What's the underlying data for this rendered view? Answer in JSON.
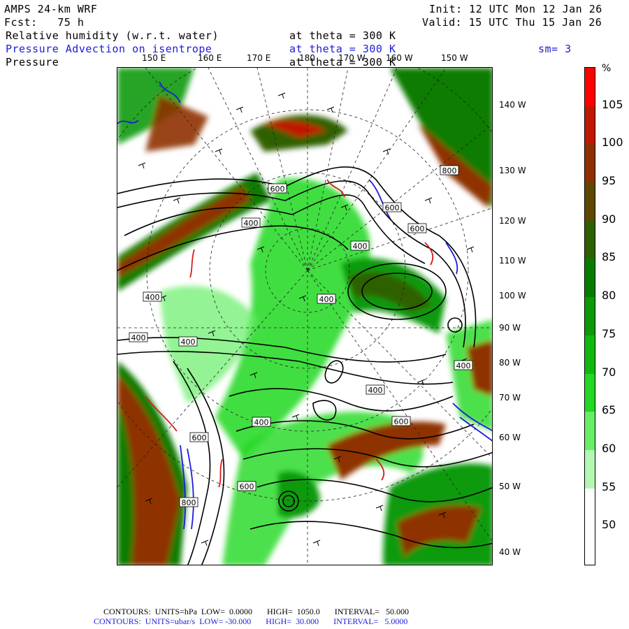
{
  "header": {
    "model": "AMPS 24-km WRF",
    "fcst": "Fcst:   75 h",
    "init": "Init: 12 UTC Mon 12 Jan 26",
    "valid": "Valid: 15 UTC Thu 15 Jan 26",
    "field1_name": "Relative humidity (w.r.t. water)",
    "field1_level": "at theta = 300 K",
    "field2_name": "Pressure Advection on isentrope",
    "field2_level": "at theta = 300 K",
    "smoothing": "sm= 3",
    "field3_name": "Pressure",
    "field3_level": "at theta = 300 K"
  },
  "lon_labels_top": [
    "150 E",
    "160 E",
    "170 E",
    "180",
    "170 W",
    "160 W",
    "150 W"
  ],
  "lat_labels_right": [
    "140 W",
    "130 W",
    "120 W",
    "110 W",
    "100 W",
    "90 W",
    "80 W",
    "70 W",
    "60 W",
    "50 W",
    "40 W"
  ],
  "colorbar": {
    "unit": "%",
    "labels": [
      "105",
      "100",
      "95",
      "90",
      "85",
      "80",
      "75",
      "70",
      "65",
      "60",
      "55",
      "50"
    ],
    "colors": [
      "#ff0000",
      "#c01800",
      "#8e3000",
      "#5e4800",
      "#2e6000",
      "#087c00",
      "#0a9a0a",
      "#10b810",
      "#22d822",
      "#66ee66",
      "#b4f6b4",
      "#ffffff",
      "#ffffff"
    ]
  },
  "contour_labels": [
    "800",
    "600",
    "600",
    "600",
    "400",
    "400",
    "400",
    "400",
    "400",
    "400",
    "400",
    "400",
    "400",
    "600",
    "600",
    "600",
    "800"
  ],
  "footer": {
    "line1": "CONTOURS:  UNITS=hPa  LOW=  0.0000       HIGH=  1050.0       INTERVAL=   50.000",
    "line2": "CONTOURS:  UNITS=ubar/s  LOW= -30.000       HIGH=  30.000       INTERVAL=   5.0000"
  }
}
